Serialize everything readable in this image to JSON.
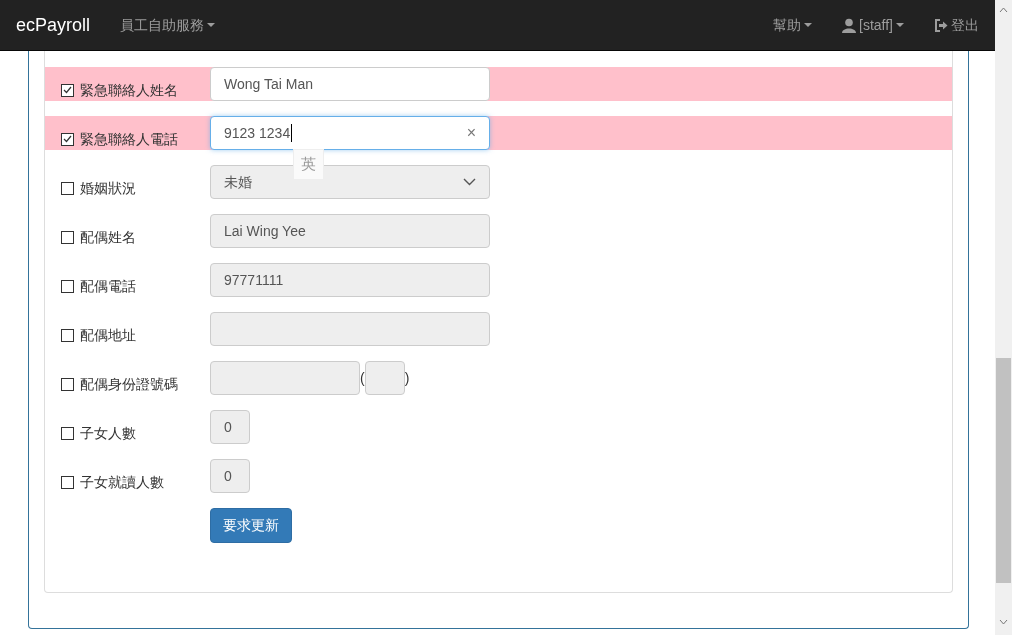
{
  "navbar": {
    "brand": "ecPayroll",
    "menu": [
      {
        "label": "員工自助服務",
        "dropdown": true
      }
    ],
    "right": [
      {
        "label": "幫助",
        "kind": "dropdown"
      },
      {
        "label": "[staff]",
        "kind": "user"
      },
      {
        "label": "登出",
        "kind": "logout"
      }
    ]
  },
  "form": {
    "rows": [
      {
        "label": "緊急聯絡人姓名",
        "checked": true,
        "kind": "text",
        "value": "Wong Tai Man",
        "focused": false
      },
      {
        "label": "緊急聯絡人電話",
        "checked": true,
        "kind": "text",
        "value": "9123 1234",
        "focused": true,
        "clear": "×"
      },
      {
        "label": "婚姻狀況",
        "checked": false,
        "kind": "select",
        "value": "未婚"
      },
      {
        "label": "配偶姓名",
        "checked": false,
        "kind": "text",
        "value": "Lai Wing Yee"
      },
      {
        "label": "配偶電話",
        "checked": false,
        "kind": "text",
        "value": "97771111"
      },
      {
        "label": "配偶地址",
        "checked": false,
        "kind": "text"
      },
      {
        "label": "配偶身份證號碼",
        "checked": false,
        "kind": "id",
        "open": "(",
        "close": ")"
      },
      {
        "label": "子女人數",
        "checked": false,
        "kind": "number",
        "value": "0"
      },
      {
        "label": "子女就讀人數",
        "checked": false,
        "kind": "number",
        "value": "0"
      }
    ],
    "submit": "要求更新"
  },
  "ime_indicator": "英"
}
